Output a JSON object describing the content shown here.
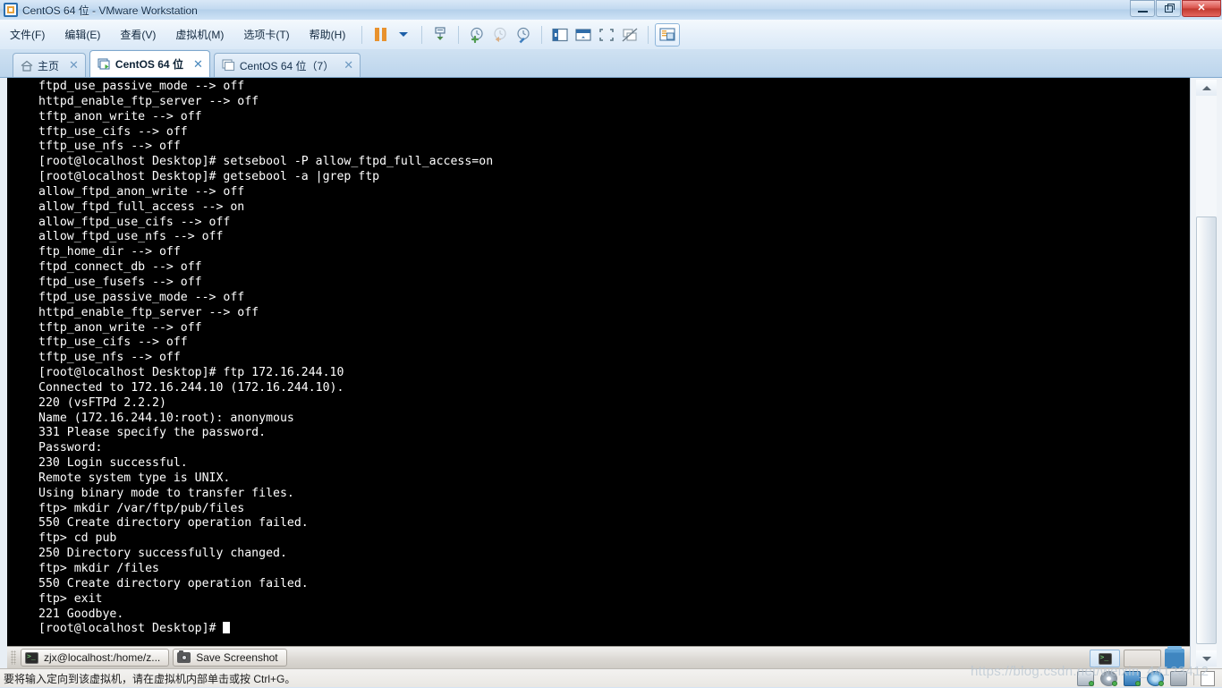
{
  "window": {
    "title": "CentOS 64 位 - VMware Workstation",
    "app_icon": "vmware-icon",
    "controls": {
      "minimize": "minimize-icon",
      "restore": "restore-icon",
      "close": "✕"
    }
  },
  "menubar": {
    "items": [
      {
        "label": "文件(F)",
        "name": "menu-file"
      },
      {
        "label": "编辑(E)",
        "name": "menu-edit"
      },
      {
        "label": "查看(V)",
        "name": "menu-view"
      },
      {
        "label": "虚拟机(M)",
        "name": "menu-vm"
      },
      {
        "label": "选项卡(T)",
        "name": "menu-tabs"
      },
      {
        "label": "帮助(H)",
        "name": "menu-help"
      }
    ]
  },
  "toolbar": {
    "buttons": [
      {
        "name": "suspend-button",
        "icon": "pause-icon"
      },
      {
        "name": "power-dropdown-button",
        "icon": "chevron-down-icon"
      },
      {
        "name": "send-ctrl-alt-del-button",
        "icon": "send-key-icon"
      },
      {
        "name": "take-snapshot-button",
        "icon": "snapshot-add-icon"
      },
      {
        "name": "revert-snapshot-button",
        "icon": "snapshot-revert-icon"
      },
      {
        "name": "manage-snapshots-button",
        "icon": "snapshot-manage-icon"
      },
      {
        "name": "show-library-button",
        "icon": "library-panel-icon"
      },
      {
        "name": "show-thumbnail-bar-button",
        "icon": "thumbnail-bar-icon"
      },
      {
        "name": "enter-fullscreen-button",
        "icon": "fullscreen-icon"
      },
      {
        "name": "unity-mode-button",
        "icon": "unity-mode-icon"
      },
      {
        "name": "console-view-button",
        "icon": "console-view-icon"
      }
    ]
  },
  "tabs": [
    {
      "label": "主页",
      "name": "tab-home",
      "icon": "home-icon",
      "active": false,
      "closable": true
    },
    {
      "label": "CentOS 64 位",
      "name": "tab-centos-64",
      "icon": "vm-running-icon",
      "active": true,
      "closable": true
    },
    {
      "label": "CentOS 64 位（7）",
      "name": "tab-centos-64-7",
      "icon": "vm-icon",
      "active": false,
      "closable": true
    }
  ],
  "terminal": {
    "lines": [
      "ftpd_use_passive_mode --> off",
      "httpd_enable_ftp_server --> off",
      "tftp_anon_write --> off",
      "tftp_use_cifs --> off",
      "tftp_use_nfs --> off",
      "[root@localhost Desktop]# setsebool -P allow_ftpd_full_access=on",
      "[root@localhost Desktop]# getsebool -a |grep ftp",
      "allow_ftpd_anon_write --> off",
      "allow_ftpd_full_access --> on",
      "allow_ftpd_use_cifs --> off",
      "allow_ftpd_use_nfs --> off",
      "ftp_home_dir --> off",
      "ftpd_connect_db --> off",
      "ftpd_use_fusefs --> off",
      "ftpd_use_passive_mode --> off",
      "httpd_enable_ftp_server --> off",
      "tftp_anon_write --> off",
      "tftp_use_cifs --> off",
      "tftp_use_nfs --> off",
      "[root@localhost Desktop]# ftp 172.16.244.10",
      "Connected to 172.16.244.10 (172.16.244.10).",
      "220 (vsFTPd 2.2.2)",
      "Name (172.16.244.10:root): anonymous",
      "331 Please specify the password.",
      "Password:",
      "230 Login successful.",
      "Remote system type is UNIX.",
      "Using binary mode to transfer files.",
      "ftp> mkdir /var/ftp/pub/files",
      "550 Create directory operation failed.",
      "ftp> cd pub",
      "250 Directory successfully changed.",
      "ftp> mkdir /files",
      "550 Create directory operation failed.",
      "ftp> exit",
      "221 Goodbye.",
      "[root@localhost Desktop]# "
    ],
    "prompt_cursor": "block-cursor",
    "foreground": "#ffffff",
    "background": "#000000"
  },
  "guest_taskbar": {
    "items": [
      {
        "label": "zjx@localhost:/home/z...",
        "name": "taskbar-terminal",
        "icon": "terminal-icon"
      },
      {
        "label": "Save Screenshot",
        "name": "taskbar-save-screenshot",
        "icon": "camera-icon"
      }
    ]
  },
  "statusbar": {
    "message": "要将输入定向到该虚拟机，请在虚拟机内部单击或按 Ctrl+G。",
    "devices": [
      {
        "name": "status-harddisk-icon"
      },
      {
        "name": "status-cdrom-icon"
      },
      {
        "name": "status-network-icon"
      },
      {
        "name": "status-usb-icon"
      },
      {
        "name": "status-camera-icon"
      },
      {
        "name": "status-printer-icon"
      }
    ]
  },
  "watermark": {
    "text": "https://blog.csdn.net/weixin_44123412"
  },
  "scrollbar": {
    "up_arrow": "scroll-up-icon",
    "down_arrow": "scroll-down-icon"
  }
}
